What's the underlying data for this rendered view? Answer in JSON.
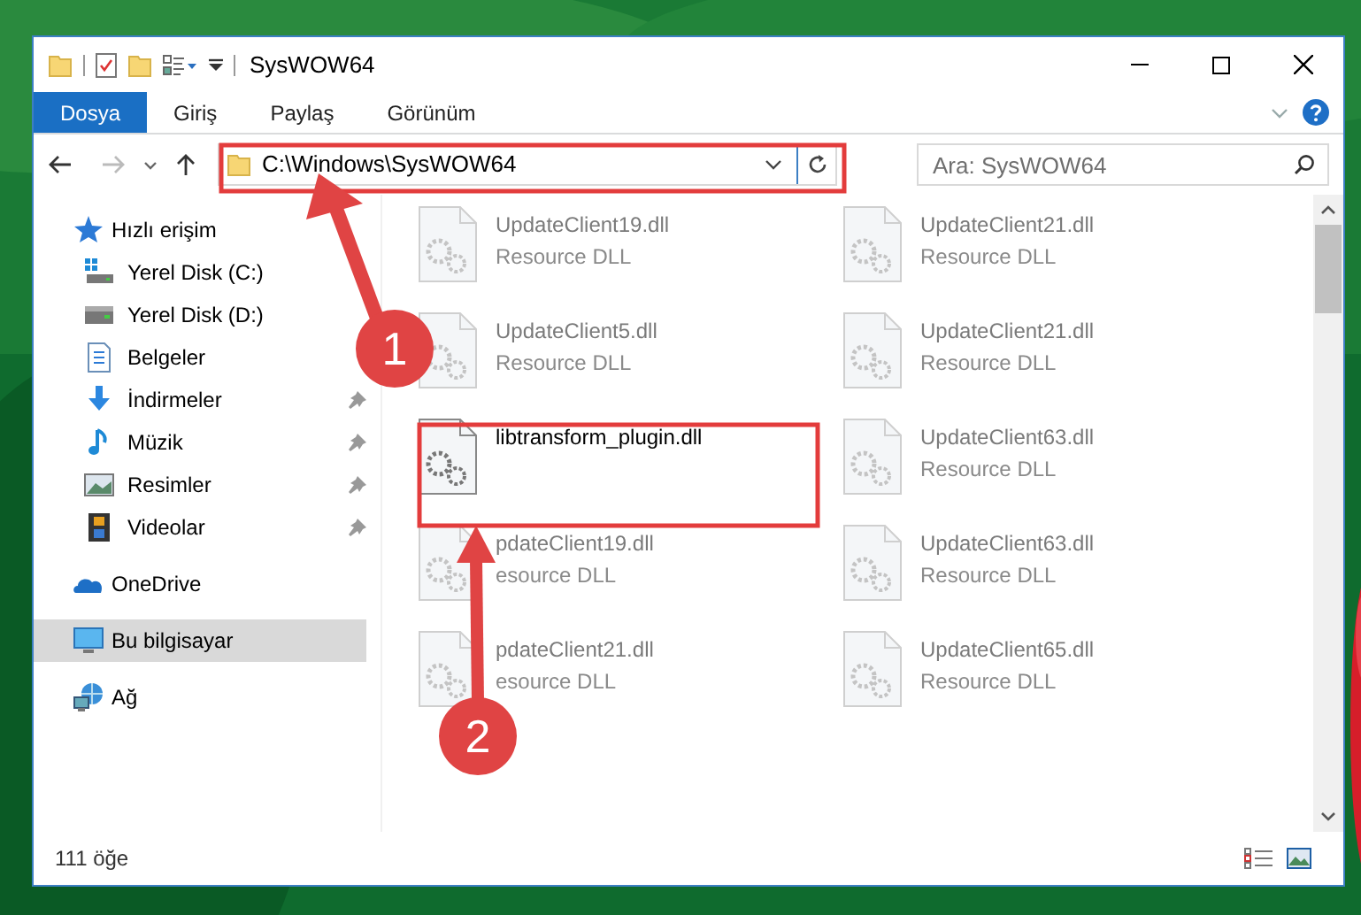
{
  "window": {
    "title": "SysWOW64"
  },
  "ribbon_tabs": [
    {
      "label": "Dosya",
      "selected": true
    },
    {
      "label": "Giriş",
      "selected": false
    },
    {
      "label": "Paylaş",
      "selected": false
    },
    {
      "label": "Görünüm",
      "selected": false
    }
  ],
  "address": {
    "path": "C:\\Windows\\SysWOW64"
  },
  "search": {
    "placeholder": "Ara: SysWOW64"
  },
  "sidebar": {
    "items": [
      {
        "label": "Hızlı erişim",
        "kind": "star",
        "selected": false,
        "children": [
          {
            "label": "Yerel Disk (C:)",
            "kind": "drive-windows",
            "pinned": false
          },
          {
            "label": "Yerel Disk (D:)",
            "kind": "drive",
            "pinned": false
          },
          {
            "label": "Belgeler",
            "kind": "documents",
            "pinned": false
          },
          {
            "label": "İndirmeler",
            "kind": "download",
            "pinned": true
          },
          {
            "label": "Müzik",
            "kind": "music",
            "pinned": true
          },
          {
            "label": "Resimler",
            "kind": "pictures",
            "pinned": true
          },
          {
            "label": "Videolar",
            "kind": "videos",
            "pinned": true
          }
        ]
      },
      {
        "label": "OneDrive",
        "kind": "cloud",
        "selected": false
      },
      {
        "label": "Bu bilgisayar",
        "kind": "computer",
        "selected": true
      },
      {
        "label": "Ağ",
        "kind": "network",
        "selected": false
      }
    ]
  },
  "files": [
    {
      "name": "UpdateClient19.dll",
      "type": "Resource DLL",
      "blurred": true
    },
    {
      "name": "UpdateClient21.dll",
      "type": "Resource DLL",
      "blurred": true
    },
    {
      "name": "UpdateClient5.dll",
      "type": "Resource DLL",
      "blurred": true
    },
    {
      "name": "UpdateClient21.dll",
      "type": "Resource DLL",
      "blurred": true
    },
    {
      "name": "libtransform_plugin.dll",
      "blurred": false
    },
    {
      "name": "UpdateClient63.dll",
      "type": "Resource DLL",
      "blurred": true
    },
    {
      "name": "pdateClient19.dll",
      "type": "esource DLL",
      "blurred": true
    },
    {
      "name": "UpdateClient63.dll",
      "type": "Resource DLL",
      "blurred": true
    },
    {
      "name": "pdateClient21.dll",
      "type": "esource DLL",
      "blurred": true
    },
    {
      "name": "UpdateClient65.dll",
      "type": "Resource DLL",
      "blurred": true
    }
  ],
  "status_bar": {
    "item_count": "111 öğe"
  },
  "annotations": [
    {
      "number": "1"
    },
    {
      "number": "2"
    }
  ]
}
